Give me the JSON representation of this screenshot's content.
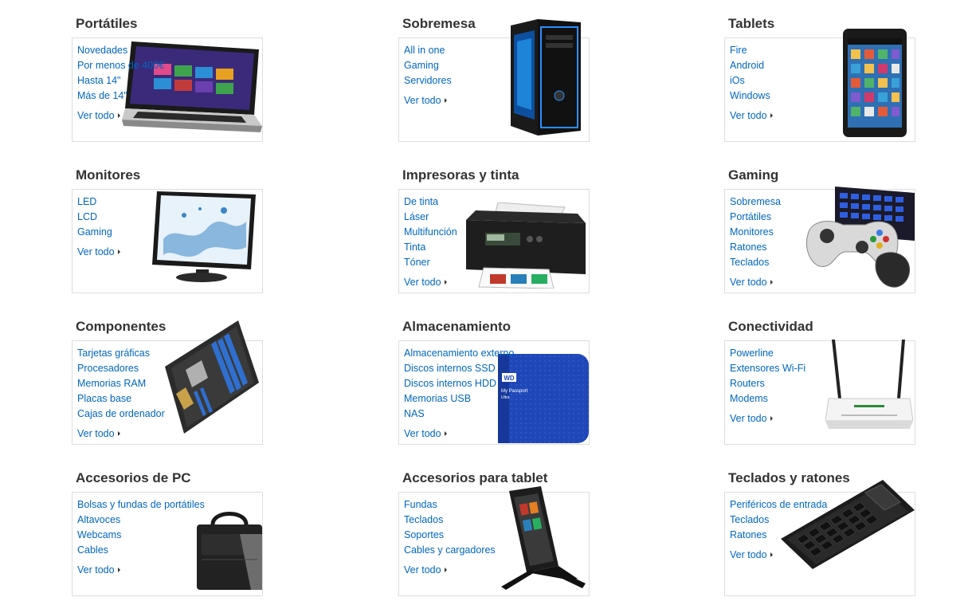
{
  "categories": [
    {
      "title": "Portátiles",
      "links": [
        "Novedades",
        "Por menos de 400€",
        "Hasta 14\"",
        "Más de 14\""
      ],
      "more": "Ver todo",
      "icon": "laptop-icon"
    },
    {
      "title": "Sobremesa",
      "links": [
        "All in one",
        "Gaming",
        "Servidores"
      ],
      "more": "Ver todo",
      "icon": "desktop-tower-icon"
    },
    {
      "title": "Tablets",
      "links": [
        "Fire",
        "Android",
        "iOs",
        "Windows"
      ],
      "more": "Ver todo",
      "icon": "tablet-icon"
    },
    {
      "title": "Monitores",
      "links": [
        "LED",
        "LCD",
        "Gaming"
      ],
      "more": "Ver todo",
      "icon": "monitor-icon"
    },
    {
      "title": "Impresoras y tinta",
      "links": [
        "De tinta",
        "Láser",
        "Multifunción",
        "Tinta",
        "Tóner"
      ],
      "more": "Ver todo",
      "icon": "printer-icon"
    },
    {
      "title": "Gaming",
      "links": [
        "Sobremesa",
        "Portátiles",
        "Monitores",
        "Ratones",
        "Teclados"
      ],
      "more": "Ver todo",
      "icon": "gamepad-keyboard-icon"
    },
    {
      "title": "Componentes",
      "links": [
        "Tarjetas gráficas",
        "Procesadores",
        "Memorias RAM",
        "Placas base",
        "Cajas de ordenador"
      ],
      "more": "Ver todo",
      "icon": "motherboard-icon"
    },
    {
      "title": "Almacenamiento",
      "links": [
        "Almacenamiento externo",
        "Discos internos SSD",
        "Discos internos HDD",
        "Memorias USB",
        "NAS"
      ],
      "more": "Ver todo",
      "icon": "external-drive-icon",
      "drive_brand": "WD",
      "drive_model": "My Passport",
      "drive_sub": "Ultra"
    },
    {
      "title": "Conectividad",
      "links": [
        "Powerline",
        "Extensores Wi-Fi",
        "Routers",
        "Modems"
      ],
      "more": "Ver todo",
      "icon": "router-icon"
    },
    {
      "title": "Accesorios de PC",
      "links": [
        "Bolsas y fundas de portátiles",
        "Altavoces",
        "Webcams",
        "Cables"
      ],
      "more": "Ver todo",
      "icon": "laptop-bag-icon"
    },
    {
      "title": "Accesorios para tablet",
      "links": [
        "Fundas",
        "Teclados",
        "Soportes",
        "Cables y cargadores"
      ],
      "more": "Ver todo",
      "icon": "tablet-stand-icon"
    },
    {
      "title": "Teclados y ratones",
      "links": [
        "Periféricos de entrada",
        "Teclados",
        "Ratones"
      ],
      "more": "Ver todo",
      "icon": "wireless-keyboard-icon"
    }
  ],
  "colors": {
    "link": "#0066c0",
    "heading": "#333333",
    "border": "#dddddd"
  }
}
